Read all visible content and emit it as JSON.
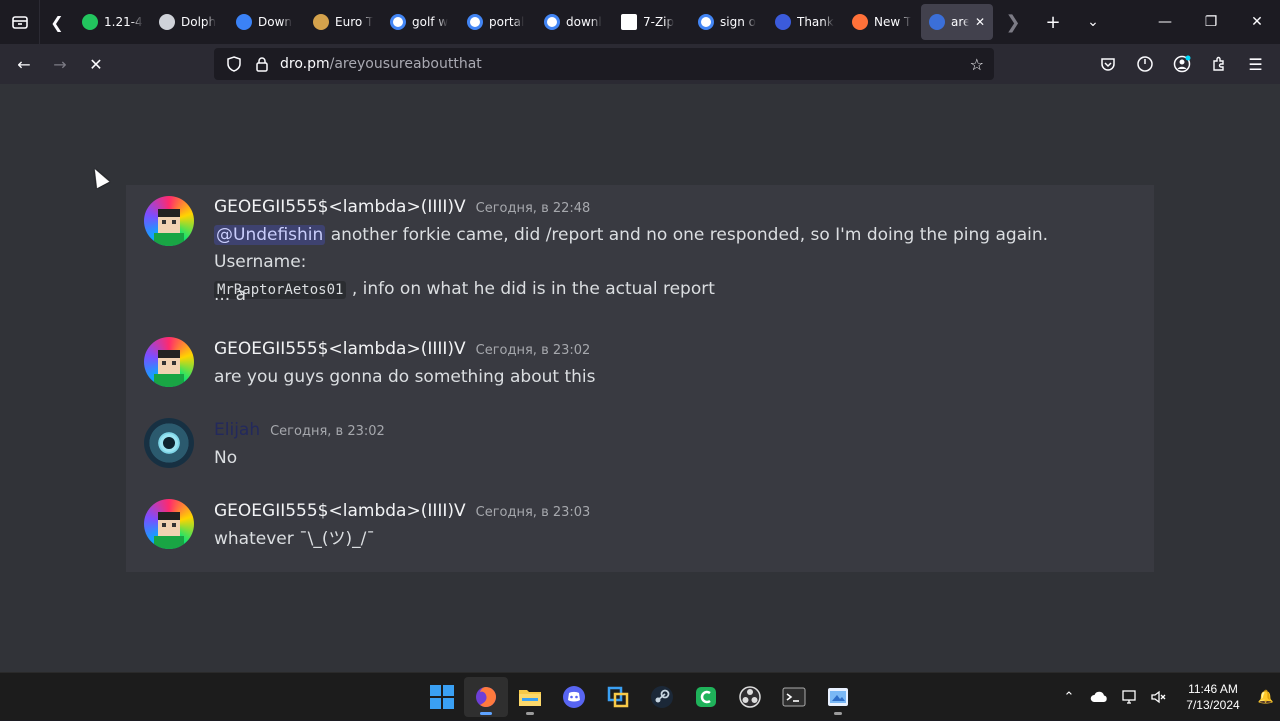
{
  "browser": {
    "tabs": [
      {
        "label": "1.21-4",
        "icon": "green-refresh-icon",
        "color": "#22c55e"
      },
      {
        "label": "Dolph",
        "icon": "dolphin-icon",
        "color": "#cfd2d9"
      },
      {
        "label": "Down",
        "icon": "download-arrow-icon",
        "color": "#3b82f6"
      },
      {
        "label": "Euro T",
        "icon": "truck-icon",
        "color": "#d4a24c"
      },
      {
        "label": "golf w",
        "icon": "google-icon",
        "color": "#ffffff"
      },
      {
        "label": "portal",
        "icon": "google-icon",
        "color": "#ffffff"
      },
      {
        "label": "downl",
        "icon": "google-icon",
        "color": "#ffffff"
      },
      {
        "label": "7-Zip",
        "icon": "7zip-icon",
        "color": "#ffffff"
      },
      {
        "label": "sign o",
        "icon": "google-icon",
        "color": "#ffffff"
      },
      {
        "label": "Thank",
        "icon": "m-logo-icon",
        "color": "#3b5bdb"
      },
      {
        "label": "New T",
        "icon": "firefox-icon",
        "color": "#ff7139"
      },
      {
        "label": "are",
        "icon": "loading-globe-icon",
        "color": "#3b6fd8",
        "active": true
      }
    ],
    "close_tab_glyph": "✕",
    "url_host": "dro.pm",
    "url_path": "/areyousureaboutthat"
  },
  "messages": [
    {
      "username": "GEOEGII555$<lambda>(IIII)V",
      "timestamp": "Сегодня, в 22:48",
      "mention": "@Undefishin",
      "text_after_mention": " another forkie came, did /report and no one responded, so I'm doing the ping again. Username:",
      "code": "MrRaptorAetos01",
      "text_after_code": " , info on what he did is in the actual report",
      "extra_line": "... a"
    },
    {
      "username": "GEOEGII555$<lambda>(IIII)V",
      "timestamp": "Сегодня, в 23:02",
      "text": "are you guys gonna do something about this"
    },
    {
      "username": "Elijah",
      "timestamp": "Сегодня, в 23:02",
      "text": "No"
    },
    {
      "username": "GEOEGII555$<lambda>(IIII)V",
      "timestamp": "Сегодня, в 23:03",
      "text": "whatever ¯\\_(ツ)_/¯"
    }
  ],
  "taskbar": {
    "apps": [
      "start-icon",
      "firefox-icon",
      "file-explorer-icon",
      "discord-icon",
      "virtualbox-icon",
      "steam-icon",
      "clipchamp-icon",
      "obs-icon",
      "terminal-icon",
      "paint-icon"
    ],
    "time": "11:46 AM",
    "date": "7/13/2024"
  }
}
